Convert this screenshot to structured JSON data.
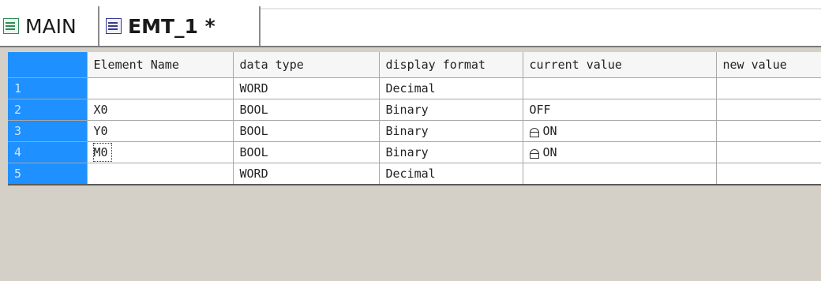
{
  "tabs": [
    {
      "label": "MAIN",
      "active": false,
      "icon": "program-icon"
    },
    {
      "label": "EMT_1 *",
      "active": true,
      "icon": "monitor-table-icon"
    }
  ],
  "table": {
    "columns": [
      "Element Name",
      "data type",
      "display format",
      "current value",
      "new value"
    ],
    "rows": [
      {
        "num": "1",
        "element_name": "",
        "data_type": "WORD",
        "display_format": "Decimal",
        "current_value": "",
        "new_value": ""
      },
      {
        "num": "2",
        "element_name": "X0",
        "data_type": "BOOL",
        "display_format": "Binary",
        "current_value": "OFF",
        "new_value": ""
      },
      {
        "num": "3",
        "element_name": "Y0",
        "data_type": "BOOL",
        "display_format": "Binary",
        "current_value": "ON",
        "new_value": ""
      },
      {
        "num": "4",
        "element_name": "M0",
        "data_type": "BOOL",
        "display_format": "Binary",
        "current_value": "ON",
        "new_value": ""
      },
      {
        "num": "5",
        "element_name": "",
        "data_type": "WORD",
        "display_format": "Decimal",
        "current_value": "",
        "new_value": ""
      }
    ]
  },
  "colors": {
    "row_header": "#1e90ff",
    "background": "#d4d0c8"
  }
}
